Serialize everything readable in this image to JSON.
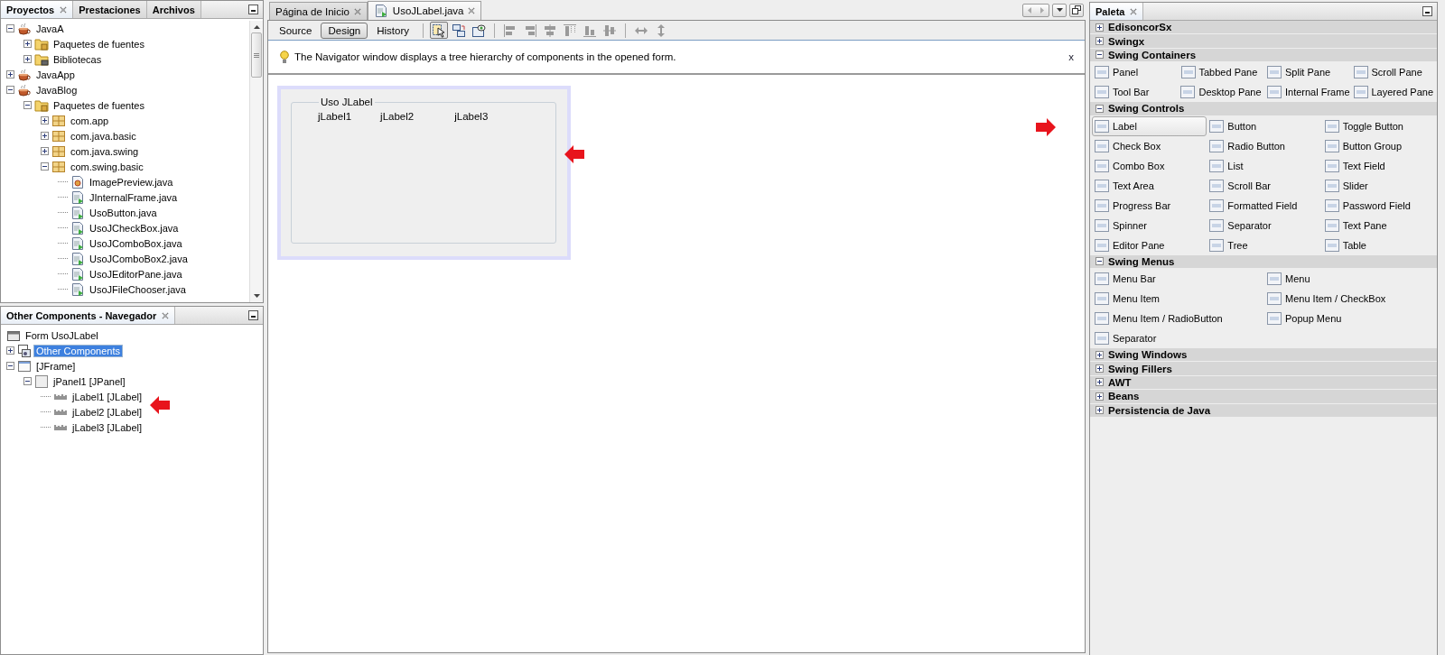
{
  "projects_panel": {
    "tabs": [
      {
        "label": "Proyectos",
        "selected": true
      },
      {
        "label": "Prestaciones",
        "selected": false
      },
      {
        "label": "Archivos",
        "selected": false
      }
    ],
    "tree": [
      {
        "label": "JavaA",
        "kind": "project",
        "expanded": true,
        "children": [
          {
            "label": "Paquetes de fuentes",
            "kind": "source-folder",
            "expanded": false
          },
          {
            "label": "Bibliotecas",
            "kind": "library-folder",
            "expanded": false
          }
        ]
      },
      {
        "label": "JavaApp",
        "kind": "project",
        "expanded": false
      },
      {
        "label": "JavaBlog",
        "kind": "project",
        "expanded": true,
        "children": [
          {
            "label": "Paquetes de fuentes",
            "kind": "source-folder",
            "expanded": true,
            "children": [
              {
                "label": "com.app",
                "kind": "package",
                "expanded": false
              },
              {
                "label": "com.java.basic",
                "kind": "package",
                "expanded": false
              },
              {
                "label": "com.java.swing",
                "kind": "package",
                "expanded": false
              },
              {
                "label": "com.swing.basic",
                "kind": "package",
                "expanded": true,
                "children": [
                  {
                    "label": "ImagePreview.java",
                    "kind": "class-file"
                  },
                  {
                    "label": "JInternalFrame.java",
                    "kind": "form-file"
                  },
                  {
                    "label": "UsoButton.java",
                    "kind": "form-file"
                  },
                  {
                    "label": "UsoJCheckBox.java",
                    "kind": "form-file"
                  },
                  {
                    "label": "UsoJComboBox.java",
                    "kind": "form-file"
                  },
                  {
                    "label": "UsoJComboBox2.java",
                    "kind": "form-file"
                  },
                  {
                    "label": "UsoJEditorPane.java",
                    "kind": "form-file"
                  },
                  {
                    "label": "UsoJFileChooser.java",
                    "kind": "form-file"
                  }
                ]
              }
            ]
          }
        ]
      }
    ]
  },
  "navigator_panel": {
    "title": "Other Components - Navegador",
    "tree": [
      {
        "label": "Form UsoJLabel",
        "kind": "form",
        "selected": false
      },
      {
        "label": "Other Components",
        "kind": "components",
        "expanded": false,
        "selected": true
      },
      {
        "label": "[JFrame]",
        "kind": "frame",
        "expanded": true,
        "selected": false,
        "children": [
          {
            "label": "jPanel1 [JPanel]",
            "kind": "panel",
            "expanded": true,
            "selected": false,
            "children": [
              {
                "label": "jLabel1 [JLabel]",
                "kind": "label",
                "selected": false
              },
              {
                "label": "jLabel2 [JLabel]",
                "kind": "label",
                "selected": false
              },
              {
                "label": "jLabel3 [JLabel]",
                "kind": "label",
                "selected": false
              }
            ]
          }
        ]
      }
    ]
  },
  "editor": {
    "tabs": [
      {
        "label": "Página de Inicio",
        "kind": "page",
        "selected": false
      },
      {
        "label": "UsoJLabel.java",
        "kind": "form-file",
        "selected": true
      }
    ],
    "view_buttons": [
      {
        "label": "Source",
        "selected": false
      },
      {
        "label": "Design",
        "selected": true
      },
      {
        "label": "History",
        "selected": false
      }
    ],
    "tools": [
      {
        "kind": "selection-mode",
        "selected": true,
        "disabled": false
      },
      {
        "kind": "connection-mode",
        "selected": false,
        "disabled": false
      },
      {
        "kind": "preview",
        "selected": false,
        "disabled": false
      },
      {
        "kind": "align-left",
        "selected": false,
        "disabled": true
      },
      {
        "kind": "align-right",
        "selected": false,
        "disabled": true
      },
      {
        "kind": "center-horizontal",
        "selected": false,
        "disabled": true
      },
      {
        "kind": "align-top",
        "selected": false,
        "disabled": true
      },
      {
        "kind": "align-bottom",
        "selected": false,
        "disabled": true
      },
      {
        "kind": "center-vertical",
        "selected": false,
        "disabled": true
      },
      {
        "kind": "resize-horizontal",
        "selected": false,
        "disabled": true
      },
      {
        "kind": "resize-vertical",
        "selected": false,
        "disabled": true
      }
    ],
    "hint": {
      "text": "The Navigator window displays a tree hierarchy of components in the opened form.",
      "close": "x"
    },
    "form": {
      "title": "Uso JLabel",
      "labels": [
        "jLabel1",
        "jLabel2",
        "jLabel3"
      ]
    }
  },
  "palette": {
    "title": "Paleta",
    "sections": [
      {
        "title": "EdisoncorSx",
        "expanded": false
      },
      {
        "title": "Swingx",
        "expanded": false
      },
      {
        "title": "Swing Containers",
        "expanded": true,
        "rows": [
          [
            {
              "label": "Panel",
              "selected": false
            },
            {
              "label": "Tabbed Pane",
              "selected": false
            },
            {
              "label": "Split Pane",
              "selected": false
            },
            {
              "label": "Scroll Pane",
              "selected": false
            }
          ],
          [
            {
              "label": "Tool Bar",
              "selected": false
            },
            {
              "label": "Desktop Pane",
              "selected": false
            },
            {
              "label": "Internal Frame",
              "selected": false
            },
            {
              "label": "Layered Pane",
              "selected": false
            }
          ]
        ]
      },
      {
        "title": "Swing Controls",
        "expanded": true,
        "rows": [
          [
            {
              "label": "Label",
              "selected": true
            },
            {
              "label": "Button",
              "selected": false
            },
            {
              "label": "Toggle Button",
              "selected": false
            }
          ],
          [
            {
              "label": "Check Box",
              "selected": false
            },
            {
              "label": "Radio Button",
              "selected": false
            },
            {
              "label": "Button Group",
              "selected": false
            }
          ],
          [
            {
              "label": "Combo Box",
              "selected": false
            },
            {
              "label": "List",
              "selected": false
            },
            {
              "label": "Text Field",
              "selected": false
            }
          ],
          [
            {
              "label": "Text Area",
              "selected": false
            },
            {
              "label": "Scroll Bar",
              "selected": false
            },
            {
              "label": "Slider",
              "selected": false
            }
          ],
          [
            {
              "label": "Progress Bar",
              "selected": false
            },
            {
              "label": "Formatted Field",
              "selected": false
            },
            {
              "label": "Password Field",
              "selected": false
            }
          ],
          [
            {
              "label": "Spinner",
              "selected": false
            },
            {
              "label": "Separator",
              "selected": false
            },
            {
              "label": "Text Pane",
              "selected": false
            }
          ],
          [
            {
              "label": "Editor Pane",
              "selected": false
            },
            {
              "label": "Tree",
              "selected": false
            },
            {
              "label": "Table",
              "selected": false
            }
          ]
        ]
      },
      {
        "title": "Swing Menus",
        "expanded": true,
        "rows": [
          [
            {
              "label": "Menu Bar",
              "selected": false
            },
            {
              "label": "Menu",
              "selected": false
            }
          ],
          [
            {
              "label": "Menu Item",
              "selected": false
            },
            {
              "label": "Menu Item / CheckBox",
              "selected": false
            }
          ],
          [
            {
              "label": "Menu Item / RadioButton",
              "selected": false
            },
            {
              "label": "Popup Menu",
              "selected": false
            }
          ],
          [
            {
              "label": "Separator",
              "selected": false
            }
          ]
        ]
      },
      {
        "title": "Swing Windows",
        "expanded": false
      },
      {
        "title": "Swing Fillers",
        "expanded": false
      },
      {
        "title": "AWT",
        "expanded": false
      },
      {
        "title": "Beans",
        "expanded": false
      },
      {
        "title": "Persistencia de Java",
        "expanded": false
      }
    ]
  }
}
